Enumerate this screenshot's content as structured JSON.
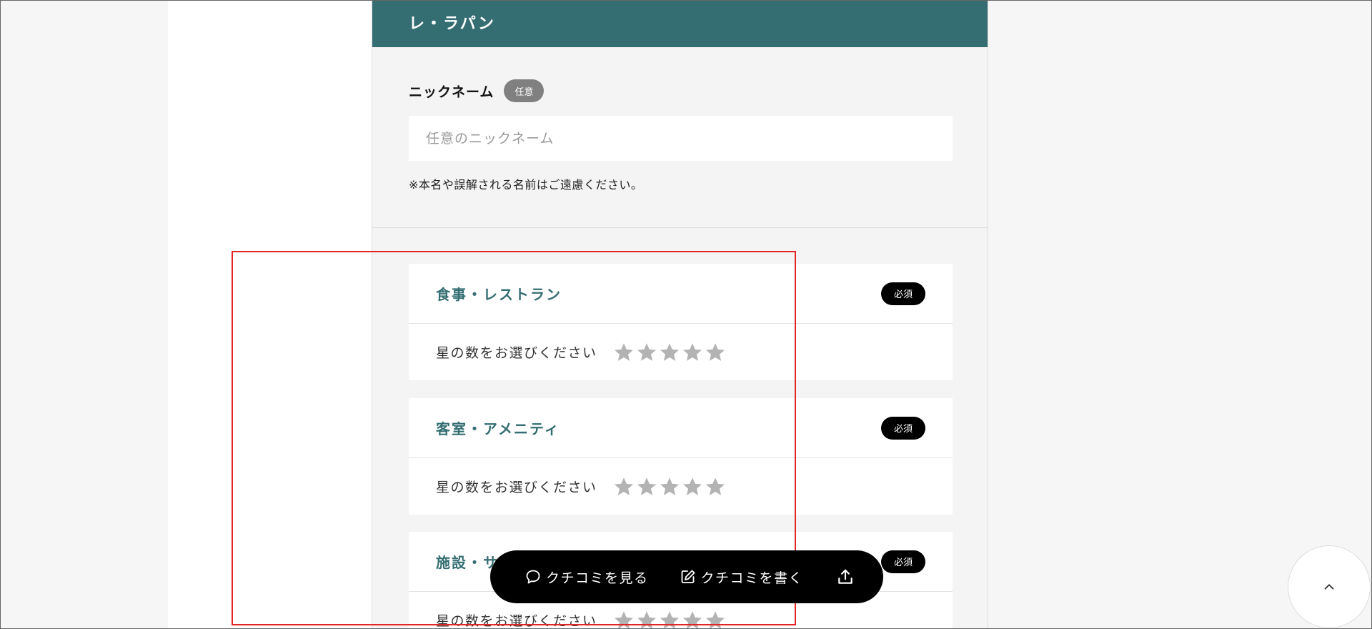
{
  "hotel": {
    "name": "レ・ラパン"
  },
  "nickname": {
    "label": "ニックネーム",
    "badge": "任意",
    "placeholder": "任意のニックネーム",
    "value": "",
    "note": "※本名や誤解される名前はご遠慮ください。"
  },
  "ratings": [
    {
      "category": "食事・レストラン",
      "badge": "必須",
      "prompt": "星の数をお選びください",
      "stars": 0,
      "max_stars": 5
    },
    {
      "category": "客室・アメニティ",
      "badge": "必須",
      "prompt": "星の数をお選びください",
      "stars": 0,
      "max_stars": 5
    },
    {
      "category": "施設・サービス",
      "badge": "必須",
      "prompt": "星の数をお選びください",
      "stars": 0,
      "max_stars": 5
    }
  ],
  "floating_bar": {
    "view_reviews": "クチコミを見る",
    "write_review": "クチコミを書く"
  },
  "colors": {
    "brand": "#346e72",
    "star_empty": "#b3b3b3",
    "highlight": "#e32424",
    "required_badge": "#000000",
    "optional_badge": "#808080"
  },
  "icons": [
    "speech-bubble-icon",
    "pencil-edit-icon",
    "share-icon",
    "chevron-up-icon",
    "star-icon"
  ]
}
